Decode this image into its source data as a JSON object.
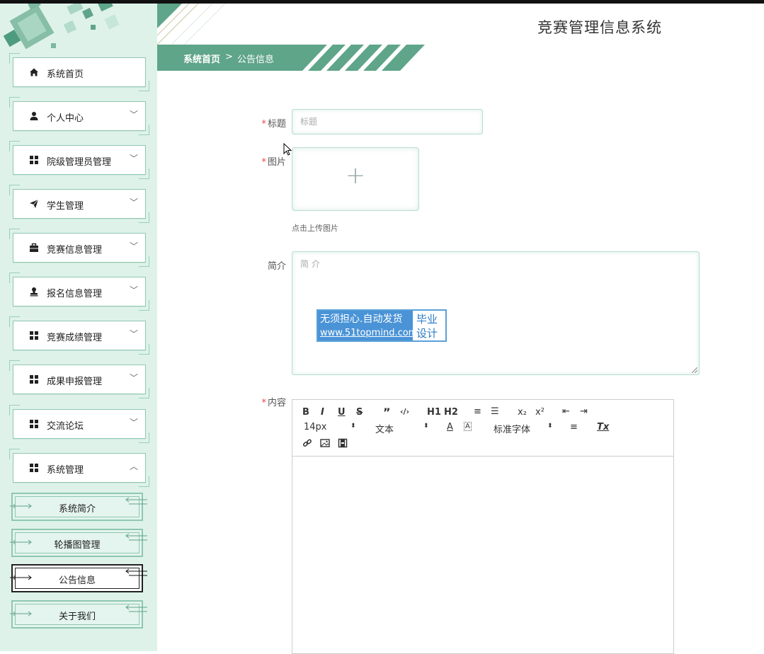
{
  "app": {
    "title": "竞赛管理信息系统"
  },
  "breadcrumb": {
    "home": "系统首页",
    "separator": ">",
    "current": "公告信息"
  },
  "sidebar": {
    "items": [
      {
        "label": "系统首页",
        "icon": "home-icon",
        "has_chevron": false
      },
      {
        "label": "个人中心",
        "icon": "user-icon",
        "chevron": "﹀"
      },
      {
        "label": "院级管理员管理",
        "icon": "grid-icon",
        "chevron": "﹀"
      },
      {
        "label": "学生管理",
        "icon": "send-icon",
        "chevron": "﹀"
      },
      {
        "label": "竞赛信息管理",
        "icon": "briefcase-icon",
        "chevron": "﹀"
      },
      {
        "label": "报名信息管理",
        "icon": "stamp-icon",
        "chevron": "﹀"
      },
      {
        "label": "竞赛成绩管理",
        "icon": "grid-icon",
        "chevron": "﹀"
      },
      {
        "label": "成果申报管理",
        "icon": "grid-icon",
        "chevron": "﹀"
      },
      {
        "label": "交流论坛",
        "icon": "grid-icon",
        "chevron": "﹀"
      },
      {
        "label": "系统管理",
        "icon": "grid-icon",
        "chevron": "︿"
      }
    ],
    "sub_items": [
      {
        "label": "系统简介",
        "active": false
      },
      {
        "label": "轮播图管理",
        "active": false
      },
      {
        "label": "公告信息",
        "active": true
      },
      {
        "label": "关于我们",
        "active": false
      }
    ]
  },
  "form": {
    "title": {
      "label": "标题",
      "required": "*",
      "placeholder": "标题"
    },
    "image": {
      "label": "图片",
      "required": "*",
      "plus": "+",
      "hint": "点击上传图片"
    },
    "intro": {
      "label": "简介",
      "placeholder": "简 介"
    },
    "content": {
      "label": "内容",
      "required": "*"
    }
  },
  "editor": {
    "buttons_row1": [
      "B",
      "I",
      "U",
      "S",
      "”",
      "‹/›",
      "H1",
      "H2",
      "≡",
      "☰",
      "x₂",
      "x²",
      "⇤",
      "⇥"
    ],
    "font_size": "14px",
    "paragraph": "文本",
    "font_color_icon": "A",
    "bg_color_icon": "A",
    "font_family": "标准字体",
    "align_icon": "≡",
    "clear_icon": "Tx",
    "row3_icons": [
      "link-icon",
      "image-icon",
      "video-icon"
    ]
  },
  "watermark": {
    "line1": "无须担心.自动发货",
    "line2": "www.51topmind.com",
    "right1": "毕业",
    "right2": "设计"
  },
  "colors": {
    "accent": "#5fa589",
    "sidebar_bg": "#def2ea",
    "border": "#8fc7b1"
  }
}
